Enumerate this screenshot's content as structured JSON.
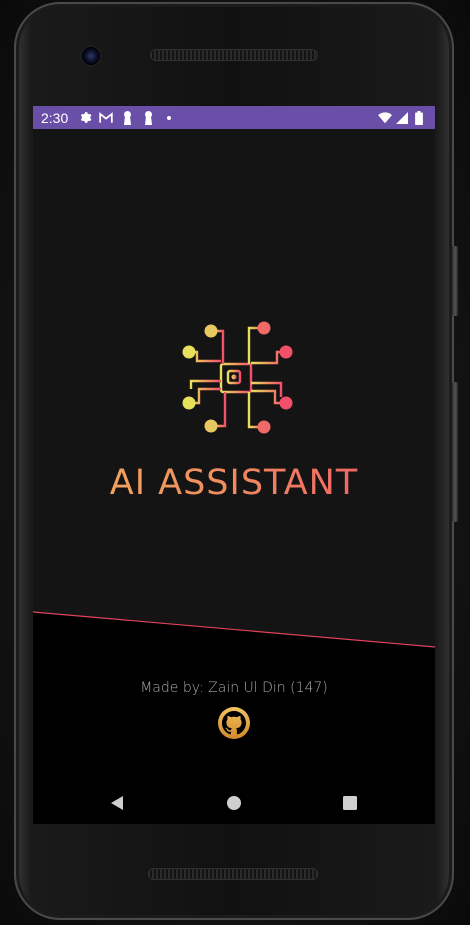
{
  "status_bar": {
    "time": "2:30",
    "left_icons": [
      "settings-icon",
      "gmail-icon",
      "keyhole-icon",
      "keyhole-icon",
      "dot-icon"
    ],
    "right_icons": [
      "wifi-icon",
      "signal-icon",
      "battery-icon"
    ],
    "color": "#6a4fa8"
  },
  "app": {
    "title": "AI ASSISTANT",
    "logo": "ai-circuit-chip-logo",
    "credits": "Made by: Zain Ul Din (147)",
    "github_icon": "github-icon",
    "accent_start": "#f1b15a",
    "accent_end": "#f0506a",
    "panel_color": "#141414",
    "divider_color": "#e0435a"
  },
  "nav": {
    "buttons": [
      "back-icon",
      "home-icon",
      "recents-icon"
    ]
  }
}
